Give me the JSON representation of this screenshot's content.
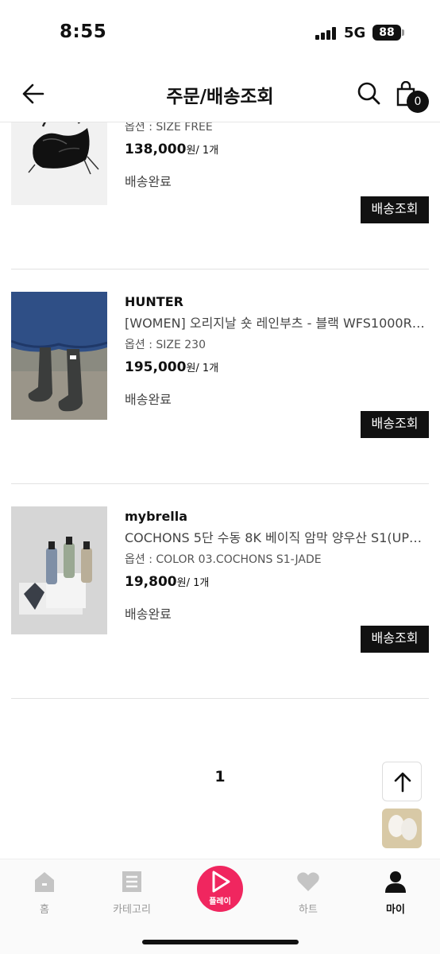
{
  "status_bar": {
    "time": "8:55",
    "network": "5G",
    "battery": "88"
  },
  "header": {
    "title": "주문/배송조회",
    "cart_count": "0"
  },
  "orders": [
    {
      "brand": "",
      "name": "",
      "option": "옵션 : SIZE FREE",
      "price": "138,000",
      "currency": "원",
      "qty": "/ 1개",
      "status": "배송완료",
      "track_label": "배송조회"
    },
    {
      "brand": "HUNTER",
      "name": "[WOMEN] 오리지날 숏 레인부츠 - 블랙 WFS1000RMA...",
      "option": "옵션 : SIZE 230",
      "price": "195,000",
      "currency": "원",
      "qty": "/ 1개",
      "status": "배송완료",
      "track_label": "배송조회"
    },
    {
      "brand": "mybrella",
      "name": "COCHONS 5단 수동 8K 베이직 암막 양우산 S1(UPF5...",
      "option": "옵션 : COLOR 03.COCHONS S1-JADE",
      "price": "19,800",
      "currency": "원",
      "qty": "/ 1개",
      "status": "배송완료",
      "track_label": "배송조회"
    }
  ],
  "pagination": {
    "current_page": "1"
  },
  "tab_bar": {
    "items": [
      {
        "label": "홈",
        "icon": "home-icon"
      },
      {
        "label": "카테고리",
        "icon": "category-list-icon"
      },
      {
        "label": "플레이",
        "icon": "play-icon"
      },
      {
        "label": "하트",
        "icon": "heart-icon"
      },
      {
        "label": "마이",
        "icon": "person-icon"
      }
    ],
    "active": "마이"
  },
  "colors": {
    "accent": "#f0265f",
    "button": "#111111"
  }
}
